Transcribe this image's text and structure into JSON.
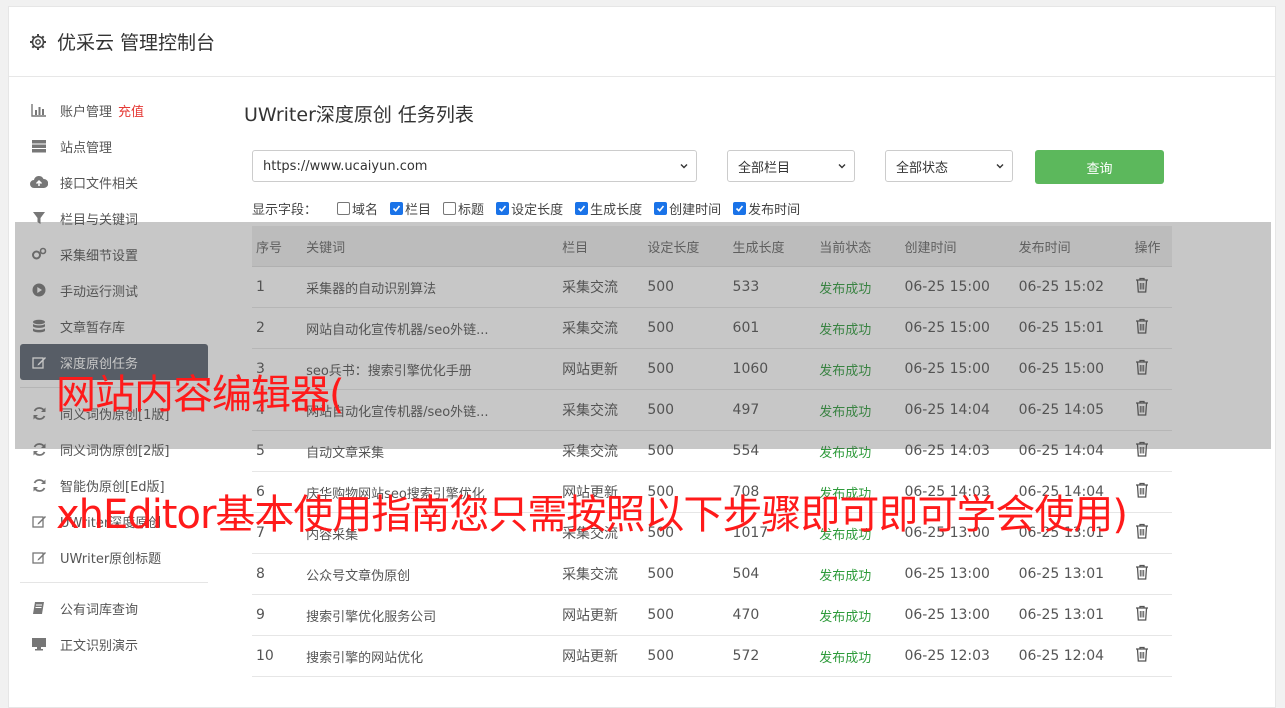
{
  "header": {
    "title": "优采云 管理控制台"
  },
  "sidebar": {
    "group1": [
      {
        "label": "账户管理",
        "icon": "bar-chart-icon",
        "extra": "充值"
      },
      {
        "label": "站点管理",
        "icon": "server-icon"
      },
      {
        "label": "接口文件相关",
        "icon": "cloud-upload-icon"
      },
      {
        "label": "栏目与关键词",
        "icon": "filter-icon"
      },
      {
        "label": "采集细节设置",
        "icon": "cogs-icon"
      },
      {
        "label": "手动运行测试",
        "icon": "play-circle-icon"
      },
      {
        "label": "文章暂存库",
        "icon": "database-icon"
      },
      {
        "label": "深度原创任务",
        "icon": "edit-icon",
        "active": true
      }
    ],
    "group2": [
      {
        "label": "同义词伪原创[1版]",
        "icon": "refresh-icon"
      },
      {
        "label": "同义词伪原创[2版]",
        "icon": "refresh-icon"
      },
      {
        "label": "智能伪原创[Ed版]",
        "icon": "refresh-icon"
      },
      {
        "label": "UWriter深度原创",
        "icon": "edit-icon"
      },
      {
        "label": "UWriter原创标题",
        "icon": "edit-icon"
      }
    ],
    "group3": [
      {
        "label": "公有词库查询",
        "icon": "book-icon"
      },
      {
        "label": "正文识别演示",
        "icon": "monitor-icon"
      }
    ]
  },
  "main": {
    "title": "UWriter深度原创 任务列表",
    "site_select": "https://www.ucaiyun.com",
    "column_select": "全部栏目",
    "status_select": "全部状态",
    "query_button": "查询",
    "fields_label": "显示字段：",
    "fields": [
      {
        "label": "域名",
        "checked": false
      },
      {
        "label": "栏目",
        "checked": true
      },
      {
        "label": "标题",
        "checked": false
      },
      {
        "label": "设定长度",
        "checked": true
      },
      {
        "label": "生成长度",
        "checked": true
      },
      {
        "label": "创建时间",
        "checked": true
      },
      {
        "label": "发布时间",
        "checked": true
      }
    ],
    "table": {
      "headers": [
        "序号",
        "关键词",
        "栏目",
        "设定长度",
        "生成长度",
        "当前状态",
        "创建时间",
        "发布时间",
        "操作"
      ],
      "rows": [
        [
          "1",
          "采集器的自动识别算法",
          "采集交流",
          "500",
          "533",
          "发布成功",
          "06-25 15:00",
          "06-25 15:02"
        ],
        [
          "2",
          "网站自动化宣传机器/seo外链...",
          "采集交流",
          "500",
          "601",
          "发布成功",
          "06-25 15:00",
          "06-25 15:01"
        ],
        [
          "3",
          "seo兵书：搜索引擎优化手册",
          "网站更新",
          "500",
          "1060",
          "发布成功",
          "06-25 15:00",
          "06-25 15:00"
        ],
        [
          "4",
          "网站自动化宣传机器/seo外链...",
          "采集交流",
          "500",
          "497",
          "发布成功",
          "06-25 14:04",
          "06-25 14:05"
        ],
        [
          "5",
          "自动文章采集",
          "采集交流",
          "500",
          "554",
          "发布成功",
          "06-25 14:03",
          "06-25 14:04"
        ],
        [
          "6",
          "庆华购物网站seo搜索引擎优化",
          "网站更新",
          "500",
          "708",
          "发布成功",
          "06-25 14:03",
          "06-25 14:04"
        ],
        [
          "7",
          "内容采集",
          "采集交流",
          "500",
          "1017",
          "发布成功",
          "06-25 13:00",
          "06-25 13:01"
        ],
        [
          "8",
          "公众号文章伪原创",
          "采集交流",
          "500",
          "504",
          "发布成功",
          "06-25 13:00",
          "06-25 13:01"
        ],
        [
          "9",
          "搜索引擎优化服务公司",
          "网站更新",
          "500",
          "470",
          "发布成功",
          "06-25 13:00",
          "06-25 13:01"
        ],
        [
          "10",
          "搜索引擎的网站优化",
          "网站更新",
          "500",
          "572",
          "发布成功",
          "06-25 12:03",
          "06-25 12:04"
        ]
      ]
    }
  },
  "overlay": {
    "line1": "网站内容编辑器(",
    "line2": "xhEditor基本使用指南您只需按照以下步骤即可即可学会使用)",
    "color": "#ff1a1a"
  }
}
